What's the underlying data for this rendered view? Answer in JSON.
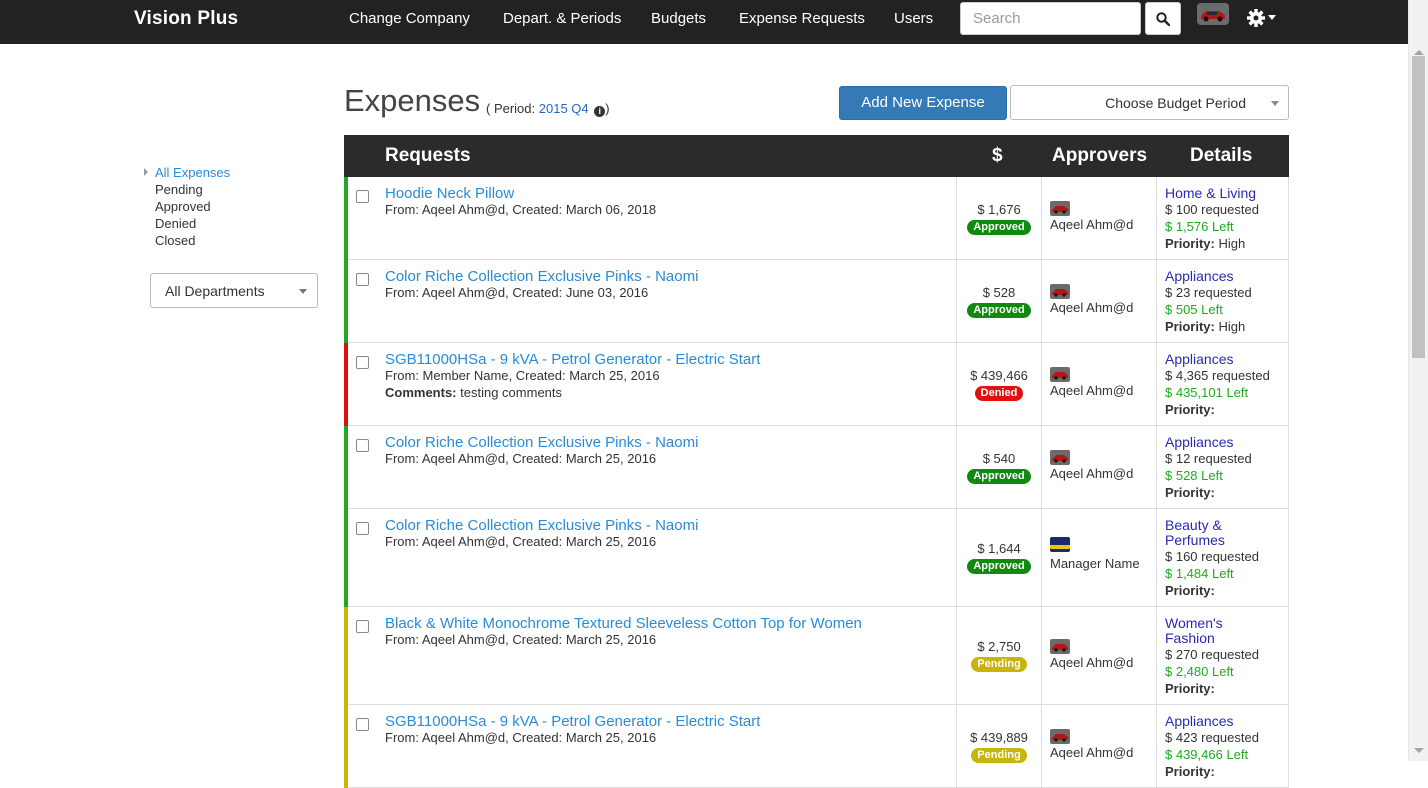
{
  "nav": {
    "brand": "Vision Plus",
    "links": [
      "Change Company",
      "Depart. & Periods",
      "Budgets",
      "Expense Requests",
      "Users"
    ],
    "search_placeholder": "Search",
    "search_icon": "search-icon",
    "settings_icon": "gear-icon"
  },
  "sidebar": {
    "filters": [
      "All Expenses",
      "Pending",
      "Approved",
      "Denied",
      "Closed"
    ],
    "active_filter": "All Expenses",
    "department_select": "All Departments"
  },
  "header": {
    "title": "Expenses",
    "period_prefix": "( Period:",
    "period_value": "2015 Q4",
    "period_suffix": ")",
    "add_button": "Add New Expense",
    "period_select": "Choose Budget Period"
  },
  "table": {
    "columns": [
      "Requests",
      "$",
      "Approvers",
      "Details"
    ],
    "rows": [
      {
        "title": "Hoodie Neck Pillow",
        "meta": "From: Aqeel Ahm@d, Created: March 06, 2018",
        "comment": "",
        "amount": "$ 1,676",
        "status": "Approved",
        "approver": "Aqeel Ahm@d",
        "category": "Home & Living",
        "requested": "$ 100 requested",
        "left": "$ 1,576 Left",
        "priority_label": "Priority:",
        "priority": "High"
      },
      {
        "title": "Color Riche Collection Exclusive Pinks - Naomi",
        "meta": "From: Aqeel Ahm@d, Created: June 03, 2016",
        "comment": "",
        "amount": "$ 528",
        "status": "Approved",
        "approver": "Aqeel Ahm@d",
        "category": "Appliances",
        "requested": "$ 23 requested",
        "left": "$ 505 Left",
        "priority_label": "Priority:",
        "priority": "High"
      },
      {
        "title": "SGB11000HSa - 9 kVA - Petrol Generator - Electric Start",
        "meta": "From: Member Name, Created: March 25, 2016",
        "comment_label": "Comments:",
        "comment": "testing comments",
        "amount": "$ 439,466",
        "status": "Denied",
        "approver": "Aqeel Ahm@d",
        "category": "Appliances",
        "requested": "$ 4,365 requested",
        "left": "$ 435,101 Left",
        "priority_label": "Priority:",
        "priority": ""
      },
      {
        "title": "Color Riche Collection Exclusive Pinks - Naomi",
        "meta": "From: Aqeel Ahm@d, Created: March 25, 2016",
        "comment": "",
        "amount": "$ 540",
        "status": "Approved",
        "approver": "Aqeel Ahm@d",
        "category": "Appliances",
        "requested": "$ 12 requested",
        "left": "$ 528 Left",
        "priority_label": "Priority:",
        "priority": ""
      },
      {
        "title": "Color Riche Collection Exclusive Pinks - Naomi",
        "meta": "From: Aqeel Ahm@d, Created: March 25, 2016",
        "comment": "",
        "amount": "$ 1,644",
        "status": "Approved",
        "approver": "Manager Name",
        "category_lines": [
          "Beauty &",
          "Perfumes"
        ],
        "requested": "$ 160 requested",
        "left": "$ 1,484 Left",
        "priority_label": "Priority:",
        "priority": ""
      },
      {
        "title": "Black & White Monochrome Textured Sleeveless Cotton Top for Women",
        "meta": "From: Aqeel Ahm@d, Created: March 25, 2016",
        "comment": "",
        "amount": "$ 2,750",
        "status": "Pending",
        "approver": "Aqeel Ahm@d",
        "category_lines": [
          "Women's",
          "Fashion"
        ],
        "requested": "$ 270 requested",
        "left": "$ 2,480 Left",
        "priority_label": "Priority:",
        "priority": ""
      },
      {
        "title": "SGB11000HSa - 9 kVA - Petrol Generator - Electric Start",
        "meta": "From: Aqeel Ahm@d, Created: March 25, 2016",
        "comment": "",
        "amount": "$ 439,889",
        "status": "Pending",
        "approver": "Aqeel Ahm@d",
        "category": "Appliances",
        "requested": "$ 423 requested",
        "left": "$ 439,466 Left",
        "priority_label": "Priority:",
        "priority": ""
      }
    ]
  },
  "colors": {
    "navbar": "#222222",
    "link": "#2a8bd6",
    "approved": "#0f8a0f",
    "denied": "#e01010",
    "pending": "#c8b40a",
    "left_green": "#1faa1f",
    "category": "#2a2ab0",
    "primary_button": "#337ab7"
  }
}
